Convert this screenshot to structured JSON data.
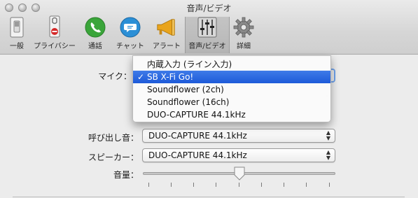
{
  "window": {
    "title": "音声/ビデオ"
  },
  "toolbar": {
    "items": [
      {
        "label": "一般",
        "icon": "general-switch-icon"
      },
      {
        "label": "プライバシー",
        "icon": "privacy-sign-icon"
      },
      {
        "label": "通話",
        "icon": "phone-icon"
      },
      {
        "label": "チャット",
        "icon": "chat-bubble-icon"
      },
      {
        "label": "アラート",
        "icon": "megaphone-icon"
      },
      {
        "label": "音声/ビデオ",
        "icon": "mixer-sliders-icon"
      },
      {
        "label": "詳細",
        "icon": "gear-icon"
      }
    ],
    "active": "音声/ビデオ"
  },
  "mic": {
    "label": "マイク：",
    "menu": {
      "options": [
        "内蔵入力 (ライン入力)",
        "SB X-Fi Go!",
        "Soundflower (2ch)",
        "Soundflower (16ch)",
        "DUO-CAPTURE 44.1kHz"
      ],
      "selected": "SB X-Fi Go!",
      "check": "✓"
    }
  },
  "ringer": {
    "label": "呼び出し音：",
    "value": "DUO-CAPTURE 44.1kHz"
  },
  "speaker": {
    "label": "スピーカー：",
    "value": "DUO-CAPTURE 44.1kHz"
  },
  "volume": {
    "label": "音量：",
    "level": 0.5
  },
  "colors": {
    "accent": "#1d5ad9",
    "phone": "#3aa53a",
    "chat": "#2b8fd6",
    "alert": "#e9a41c"
  }
}
